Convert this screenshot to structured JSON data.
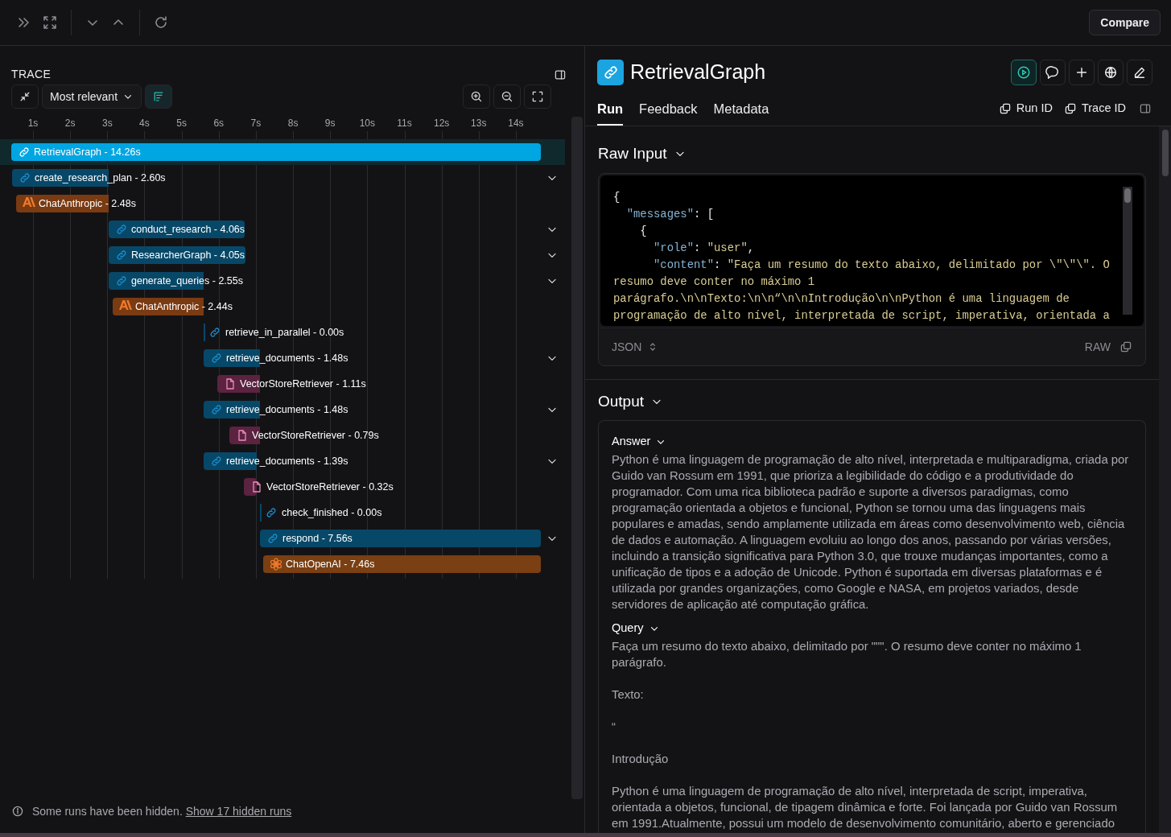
{
  "toolbar": {
    "compare_button": "Compare"
  },
  "trace": {
    "title": "TRACE",
    "sort": "Most relevant",
    "ticks": [
      "1s",
      "2s",
      "3s",
      "4s",
      "5s",
      "6s",
      "7s",
      "8s",
      "9s",
      "10s",
      "11s",
      "12s",
      "13s",
      "14s"
    ],
    "rows": [
      {
        "label": "RetrievalGraph - 14.26s",
        "kind": "chain",
        "selected": true,
        "expandable": false
      },
      {
        "label": "create_research_plan - 2.60s",
        "kind": "chain",
        "selected": false,
        "expandable": true
      },
      {
        "label": "ChatAnthropic - 2.48s",
        "kind": "anthropic",
        "selected": false,
        "expandable": false
      },
      {
        "label": "conduct_research - 4.06s",
        "kind": "chain",
        "selected": false,
        "expandable": true
      },
      {
        "label": "ResearcherGraph - 4.05s",
        "kind": "chain",
        "selected": false,
        "expandable": true
      },
      {
        "label": "generate_queries - 2.55s",
        "kind": "chain",
        "selected": false,
        "expandable": true
      },
      {
        "label": "ChatAnthropic - 2.44s",
        "kind": "anthropic",
        "selected": false,
        "expandable": false
      },
      {
        "label": "retrieve_in_parallel - 0.00s",
        "kind": "chain",
        "selected": false,
        "expandable": false
      },
      {
        "label": "retrieve_documents - 1.48s",
        "kind": "chain",
        "selected": false,
        "expandable": true
      },
      {
        "label": "VectorStoreRetriever - 1.11s",
        "kind": "retriever",
        "selected": false,
        "expandable": false
      },
      {
        "label": "retrieve_documents - 1.48s",
        "kind": "chain",
        "selected": false,
        "expandable": true
      },
      {
        "label": "VectorStoreRetriever - 0.79s",
        "kind": "retriever",
        "selected": false,
        "expandable": false
      },
      {
        "label": "retrieve_documents - 1.39s",
        "kind": "chain",
        "selected": false,
        "expandable": true
      },
      {
        "label": "VectorStoreRetriever - 0.32s",
        "kind": "retriever",
        "selected": false,
        "expandable": false
      },
      {
        "label": "check_finished - 0.00s",
        "kind": "chain",
        "selected": false,
        "expandable": false
      },
      {
        "label": "respond - 7.56s",
        "kind": "chain",
        "selected": false,
        "expandable": true
      },
      {
        "label": "ChatOpenAI - 7.46s",
        "kind": "openai",
        "selected": false,
        "expandable": false
      }
    ],
    "notice": "Some runs have been hidden.",
    "notice_link": "Show 17 hidden runs"
  },
  "run": {
    "title": "RetrievalGraph",
    "tabs": [
      {
        "label": "Run",
        "selected": true
      },
      {
        "label": "Feedback",
        "selected": false
      },
      {
        "label": "Metadata",
        "selected": false
      }
    ],
    "id_buttons": [
      "Run ID",
      "Trace ID"
    ],
    "raw_input": {
      "heading": "Raw Input",
      "format": "JSON",
      "raw_label": "RAW",
      "lines": [
        [
          {
            "t": "{",
            "kind": "punct"
          }
        ],
        [
          {
            "t": "  \"messages\"",
            "kind": "key"
          },
          {
            "t": ": [",
            "kind": "punct"
          }
        ],
        [
          {
            "t": "    {",
            "kind": "punct"
          }
        ],
        [
          {
            "t": "      \"role\"",
            "kind": "key"
          },
          {
            "t": ": ",
            "kind": "punct"
          },
          {
            "t": "\"user\"",
            "kind": "string"
          },
          {
            "t": ",",
            "kind": "punct"
          }
        ],
        [
          {
            "t": "      \"content\"",
            "kind": "key"
          },
          {
            "t": ": ",
            "kind": "punct"
          },
          {
            "t": "\"Faça um resumo do texto abaixo, delimitado por \\\"\\\"\\\". O resumo deve conter no máximo 1 parágrafo.\\n\\nTexto:\\n\\n“\\n\\nIntrodução\\n\\nPython é uma linguagem de programação de alto nível, interpretada de script, imperativa, orientada a",
            "kind": "string"
          }
        ]
      ]
    },
    "output": {
      "heading": "Output",
      "fields": [
        {
          "heading": "Answer",
          "paragraphs": [
            "Python é uma linguagem de programação de alto nível, interpretada e multiparadigma, criada por Guido van Rossum em 1991, que prioriza a legibilidade do código e a produtividade do programador. Com uma rica biblioteca padrão e suporte a diversos paradigmas, como programação orientada a objetos e funcional, Python se tornou uma das linguagens mais populares e amadas, sendo amplamente utilizada em áreas como desenvolvimento web, ciência de dados e automação. A linguagem evoluiu ao longo dos anos, passando por várias versões, incluindo a transição significativa para Python 3.0, que trouxe mudanças importantes, como a unificação de tipos e a adoção de Unicode. Python é suportada em diversas plataformas e é utilizada por grandes organizações, como Google e NASA, em projetos variados, desde servidores de aplicação até computação gráfica."
          ]
        },
        {
          "heading": "Query",
          "paragraphs": [
            "Faça um resumo do texto abaixo, delimitado por \"\"\". O resumo deve conter no máximo 1 parágrafo.",
            "Texto:",
            "“",
            "Introdução",
            "Python é uma linguagem de programação de alto nível, interpretada de script, imperativa, orientada a objetos, funcional, de tipagem dinâmica e forte. Foi lançada por Guido van Rossum em 1991.Atualmente, possui um modelo de desenvolvimento comunitário, aberto e gerenciado"
          ]
        }
      ]
    }
  }
}
